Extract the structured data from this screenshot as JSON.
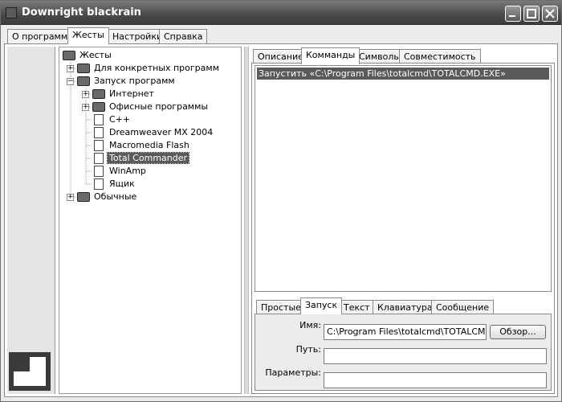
{
  "window": {
    "title": "Downright blackrain"
  },
  "main_tabs": [
    "О программе",
    "Жесты",
    "Настройки",
    "Справка"
  ],
  "tree": {
    "root": "Жесты",
    "items": [
      {
        "label": "Для конкретных программ"
      },
      {
        "label": "Запуск программ"
      },
      {
        "label": "Интернет"
      },
      {
        "label": "Офисные программы"
      },
      {
        "label": "C++"
      },
      {
        "label": "Dreamweaver MX 2004"
      },
      {
        "label": "Macromedia Flash"
      },
      {
        "label": "Total Commander"
      },
      {
        "label": "WinAmp"
      },
      {
        "label": "Ящик"
      },
      {
        "label": "Обычные"
      }
    ]
  },
  "right_tabs": [
    "Описание",
    "Комманды",
    "Символы",
    "Совместимость"
  ],
  "commands": [
    "Запустить «C:\\Program Files\\totalcmd\\TOTALCMD.EXE»"
  ],
  "action_tabs": [
    "Простые",
    "Запуск",
    "Текст",
    "Клавиатура",
    "Сообщение"
  ],
  "form": {
    "name_label": "Имя:",
    "name_value": "C:\\Program Files\\totalcmd\\TOTALCMD.E",
    "browse_label": "Обзор...",
    "path_label": "Путь:",
    "path_value": "",
    "params_label": "Параметры:",
    "params_value": ""
  }
}
